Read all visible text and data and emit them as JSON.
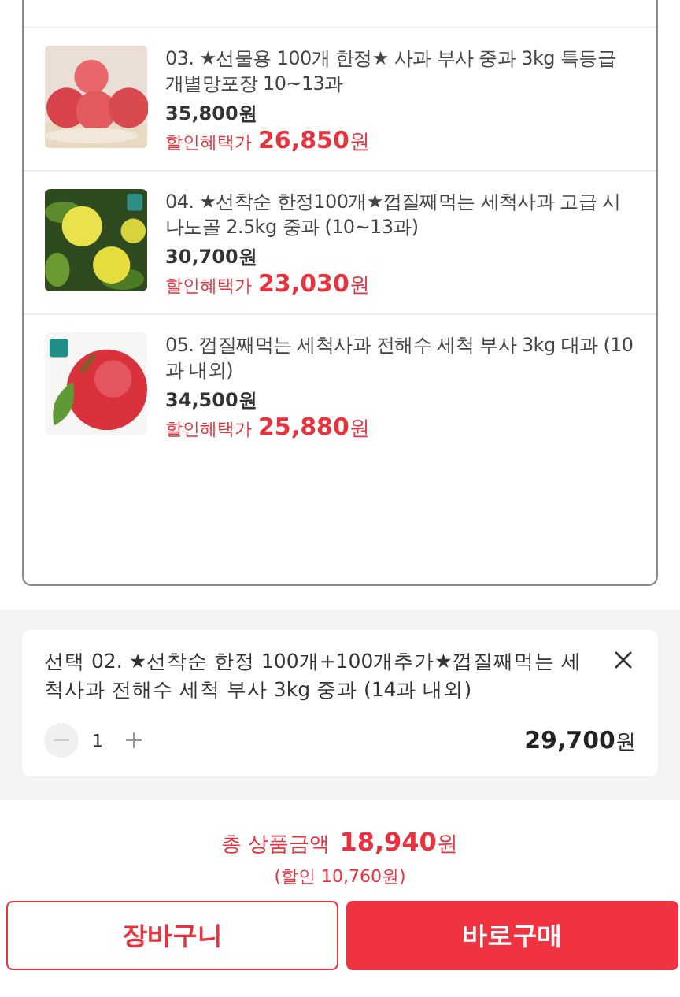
{
  "products": [
    {
      "title": "03. ★선물용 100개 한정★ 사과 부사 중과 3kg 특등급 개별망포장 10~13과",
      "price": "35,800원",
      "discount_label": "할인혜택가",
      "discount_price": "26,850",
      "currency": "원"
    },
    {
      "title": "04. ★선착순 한정100개★껍질째먹는 세척사과 고급 시나노골 2.5kg 중과 (10~13과)",
      "price": "30,700원",
      "discount_label": "할인혜택가",
      "discount_price": "23,030",
      "currency": "원"
    },
    {
      "title": "05. 껍질째먹는 세척사과 전해수 세척 부사 3kg 대과 (10과 내외)",
      "price": "34,500원",
      "discount_label": "할인혜택가",
      "discount_price": "25,880",
      "currency": "원"
    }
  ],
  "selected_option": {
    "title": "선택 02. ★선착순 한정 100개+100개추가★껍질째먹는 세척사과 전해수 세척 부사 3kg 중과 (14과 내외)",
    "quantity": "1",
    "minus_disabled": true,
    "price": "29,700",
    "currency": "원"
  },
  "total": {
    "label": "총 상품금액",
    "amount": "18,940",
    "currency": "원",
    "discount": "(할인 10,760원)"
  },
  "buttons": [
    {
      "label": "장바구니",
      "kind": "outline"
    },
    {
      "label": "바로구매",
      "kind": "primary"
    }
  ]
}
